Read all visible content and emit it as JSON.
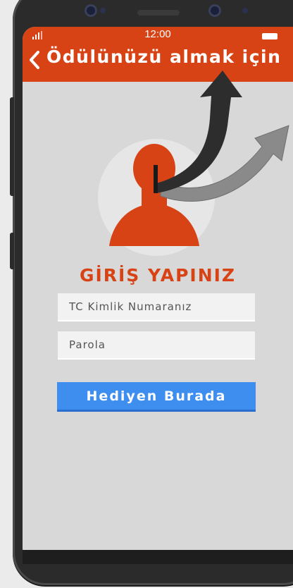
{
  "status_bar": {
    "time": "12:00"
  },
  "appbar": {
    "title": "Ödülünüzü almak için",
    "back_icon": "chevron-left-icon",
    "color": "#d84315"
  },
  "avatar": {
    "icon": "user-silhouette-icon",
    "color": "#d84315"
  },
  "annotation": {
    "icons": [
      "curved-arrow-up-icon",
      "curved-arrow-right-icon"
    ]
  },
  "login": {
    "heading": "GİRİŞ YAPINIZ",
    "tc_placeholder": "TC Kimlik Numaranız",
    "password_placeholder": "Parola",
    "submit_label": "Hediyen Burada",
    "submit_color": "#3e8ef0"
  }
}
